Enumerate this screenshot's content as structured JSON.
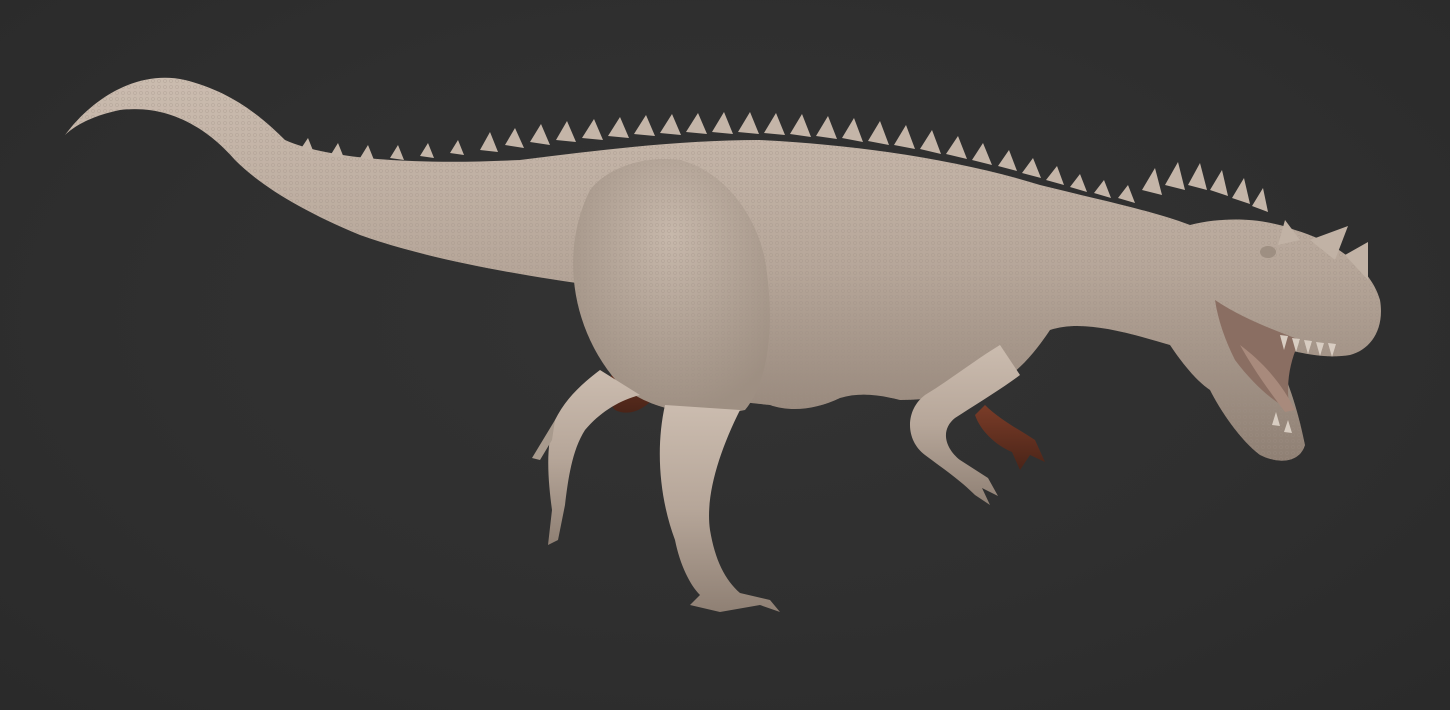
{
  "scene": {
    "subject": "dinosaur-sculpt",
    "background_color": "#2e2e2e",
    "skin_color": "#b8a89b",
    "shadow_color": "#5a2e20"
  }
}
